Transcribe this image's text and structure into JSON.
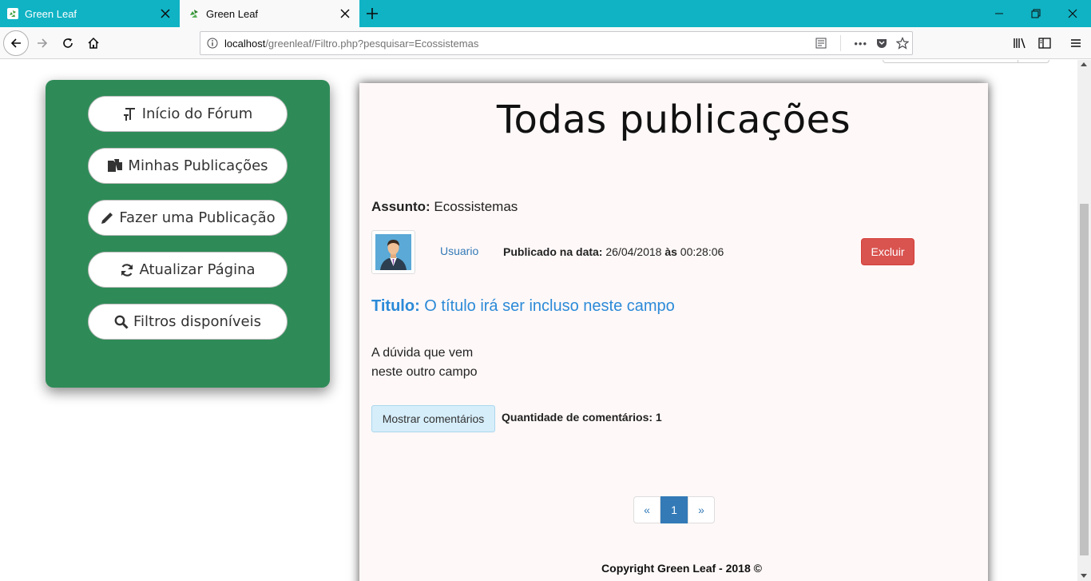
{
  "browser": {
    "tabs": [
      {
        "title": "Green Leaf",
        "active": false
      },
      {
        "title": "Green Leaf",
        "active": true
      }
    ],
    "url_host": "localhost",
    "url_path": "/greenleaf/Filtro.php?pesquisar=Ecossistemas",
    "more_icon": "•••"
  },
  "sidebar": {
    "buttons": [
      {
        "label": "Início do Fórum",
        "icon": "text-icon"
      },
      {
        "label": "Minhas Publicações",
        "icon": "files-icon"
      },
      {
        "label": "Fazer uma Publicação",
        "icon": "pencil-icon"
      },
      {
        "label": "Atualizar Página",
        "icon": "refresh-icon"
      },
      {
        "label": "Filtros disponíveis",
        "icon": "search-icon"
      }
    ],
    "color": "#2e8b57"
  },
  "main": {
    "title": "Todas publicações",
    "assunto_label": "Assunto:",
    "assunto_value": "Ecossistemas",
    "post": {
      "user": "Usuario",
      "date_label": "Publicado na data:",
      "date": "26/04/2018",
      "at_label": "às",
      "time": "00:28:06",
      "delete_label": "Excluir",
      "title_label": "Titulo:",
      "title": "O título irá ser incluso neste campo",
      "body": "        A dúvida que vem\nneste outro campo",
      "show_comments_label": "Mostrar comentários",
      "comments_count_label": "Quantidade de comentários: 1"
    },
    "pagination": {
      "prev": "«",
      "current": "1",
      "next": "»"
    },
    "copyright": "Copyright Green Leaf - 2018 ©"
  }
}
